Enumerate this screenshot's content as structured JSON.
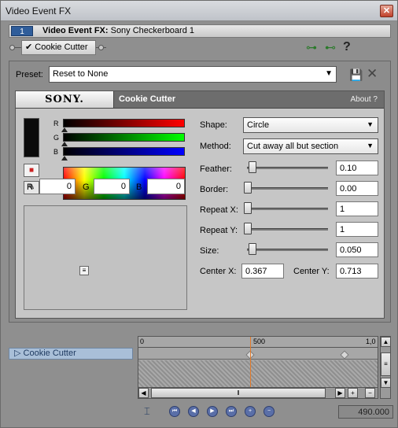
{
  "window": {
    "title": "Video Event FX",
    "close_glyph": "✕"
  },
  "fx_header": {
    "chain_index": "1",
    "label_bold": "Video Event FX:",
    "label_rest": " Sony Checkerboard 1"
  },
  "chain": {
    "plugin_label": "Cookie Cutter",
    "check": "✔",
    "icons": [
      "plugin-chain-icon",
      "remove-plugin-icon",
      "help-icon"
    ],
    "help_glyph": "?"
  },
  "preset": {
    "label": "Preset:",
    "value": "Reset to None",
    "dropdown_arrow": "▼"
  },
  "plugin": {
    "vendor": "SONY.",
    "name": "Cookie Cutter",
    "about": "About  ?"
  },
  "color": {
    "swatch_hex": "#0b0b0b",
    "bar_labels": [
      "R",
      "G",
      "B"
    ],
    "r_label": "R",
    "r_value": "0",
    "g_label": "G",
    "g_value": "0",
    "b_label": "B",
    "b_value": "0"
  },
  "params": {
    "shape_label": "Shape:",
    "shape_value": "Circle",
    "method_label": "Method:",
    "method_value": "Cut away all but section",
    "feather_label": "Feather:",
    "feather_value": "0.10",
    "border_label": "Border:",
    "border_value": "0.00",
    "repeatx_label": "Repeat X:",
    "repeatx_value": "1",
    "repeaty_label": "Repeat Y:",
    "repeaty_value": "1",
    "size_label": "Size:",
    "size_value": "0.050",
    "centerx_label": "Center X:",
    "centerx_value": "0.367",
    "centery_label": "Center Y:",
    "centery_value": "0.713"
  },
  "timeline": {
    "track_name": "Cookie Cutter",
    "ruler_labels": [
      "0",
      "500",
      "1,0"
    ],
    "time_value": "490.000"
  },
  "colors": {
    "accent": "#2f5d9a",
    "cursor": "#e27a2b",
    "track_bg": "#a9bfd8"
  }
}
